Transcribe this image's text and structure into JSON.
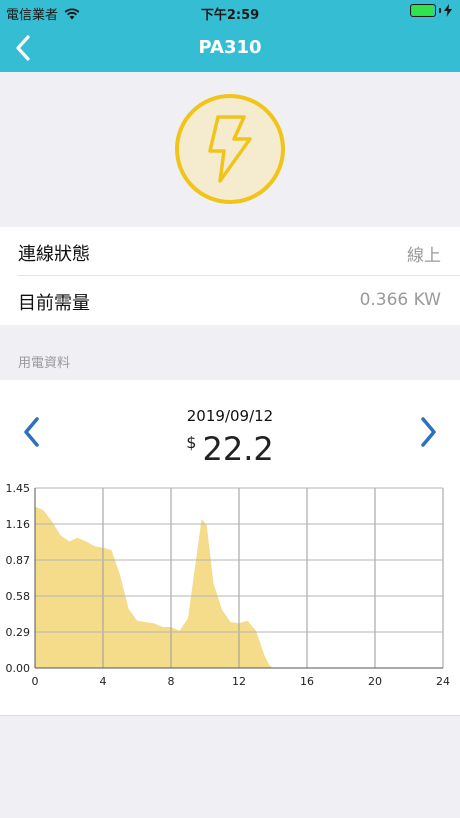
{
  "status_bar": {
    "carrier": "電信業者",
    "time": "下午2:59",
    "icons": [
      "wifi-icon",
      "battery-icon",
      "charging-bolt-icon"
    ]
  },
  "nav": {
    "title": "PA310",
    "back_icon": "chevron-left-icon"
  },
  "hero": {
    "icon": "lightning-bolt-icon",
    "colors": {
      "circle_fill": "#f5ecd0",
      "stroke": "#f0c419"
    }
  },
  "info_rows": [
    {
      "label": "連線狀態",
      "value": "線上"
    },
    {
      "label": "目前需量",
      "value": "0.366 KW"
    }
  ],
  "section": {
    "title": "用電資料"
  },
  "summary": {
    "date": "2019/09/12",
    "currency": "$",
    "amount": "22.2",
    "prev_icon": "chevron-left-icon",
    "next_icon": "chevron-right-icon"
  },
  "colors": {
    "header_bg": "#34bdd3",
    "accent_blue": "#2f6fbd",
    "area_fill": "#f4dc8a"
  },
  "chart_data": {
    "type": "area",
    "x": [
      0,
      0.5,
      1,
      1.5,
      2,
      2.5,
      3,
      3.5,
      4,
      4.5,
      5,
      5.5,
      6,
      6.5,
      7,
      7.5,
      8,
      8.5,
      9,
      9.5,
      9.8,
      10.1,
      10.5,
      11,
      11.5,
      12,
      12.5,
      13,
      13.5,
      13.8,
      14
    ],
    "y": [
      1.3,
      1.27,
      1.18,
      1.07,
      1.02,
      1.05,
      1.02,
      0.98,
      0.97,
      0.95,
      0.75,
      0.48,
      0.38,
      0.37,
      0.36,
      0.33,
      0.33,
      0.3,
      0.4,
      0.9,
      1.2,
      1.15,
      0.68,
      0.47,
      0.37,
      0.36,
      0.38,
      0.3,
      0.1,
      0.02,
      0.0
    ],
    "xticks": [
      "0",
      "4",
      "8",
      "12",
      "16",
      "20",
      "24"
    ],
    "yticks": [
      "0.00",
      "0.29",
      "0.58",
      "0.87",
      "1.16",
      "1.45"
    ],
    "xlim": [
      0,
      24
    ],
    "ylim": [
      0,
      1.45
    ],
    "grid": true
  }
}
